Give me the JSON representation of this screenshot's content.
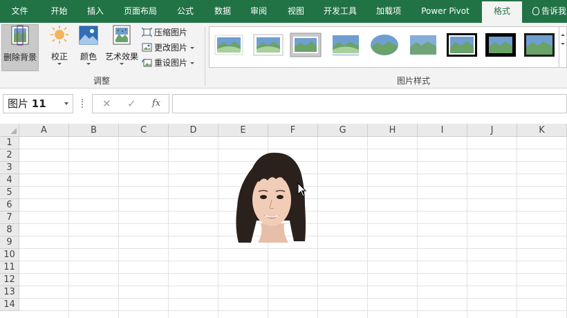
{
  "tabs": [
    {
      "label": "文件"
    },
    {
      "label": "开始"
    },
    {
      "label": "插入"
    },
    {
      "label": "页面布局"
    },
    {
      "label": "公式"
    },
    {
      "label": "数据"
    },
    {
      "label": "审阅"
    },
    {
      "label": "视图"
    },
    {
      "label": "开发工具"
    },
    {
      "label": "加载项"
    },
    {
      "label": "Power Pivot"
    },
    {
      "label": "格式",
      "active": true
    }
  ],
  "tell_me": "告诉我",
  "ribbon": {
    "remove_bg": "删除背景",
    "corrections": "校正",
    "color": "颜色",
    "artistic": "艺术效果",
    "compress": "压缩图片",
    "change": "更改图片",
    "reset": "重设图片",
    "group_adjust": "调整",
    "group_styles": "图片样式",
    "icons": [
      "remove-background-icon",
      "corrections-icon",
      "color-icon",
      "artistic-effects-icon",
      "compress-icon",
      "change-picture-icon",
      "reset-picture-icon"
    ]
  },
  "formula_bar": {
    "name_prefix": "图片",
    "name_number": "11",
    "fx": "fx",
    "value": ""
  },
  "sheet": {
    "columns": [
      "A",
      "B",
      "C",
      "D",
      "E",
      "F",
      "G",
      "H",
      "I",
      "J",
      "K"
    ],
    "rows": [
      "1",
      "2",
      "3",
      "4",
      "5",
      "6",
      "7",
      "8",
      "9",
      "10",
      "11",
      "12",
      "13",
      "14"
    ]
  },
  "colors": {
    "excel_green": "#217346",
    "ribbon_bg": "#f3f3f3",
    "header_bg": "#eaeaea"
  }
}
